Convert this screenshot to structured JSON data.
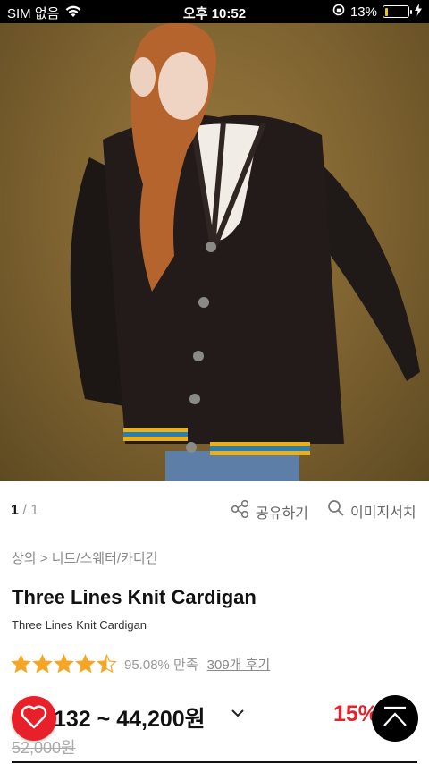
{
  "status_bar": {
    "carrier": "SIM 없음",
    "time": "오후 10:52",
    "battery_percent": "13%",
    "battery_level": 0.13,
    "battery_color": "#f5c400"
  },
  "gallery": {
    "current": "1",
    "separator": " / ",
    "total": "1",
    "share_label": "공유하기",
    "share_icon": "share-icon",
    "image_search_label": "이미지서치",
    "image_search_icon": "search-icon"
  },
  "product": {
    "breadcrumb": "상의 > 니트/스웨터/카디건",
    "title": "Three Lines Knit Cardigan",
    "subtitle": "Three Lines Knit Cardigan",
    "rating_stars": 4.5,
    "star_color": "#f5a623",
    "satisfaction": "95.08% 만족",
    "reviews": "309개 후기",
    "price_range": "132 ~ 44,200원",
    "discount": "15%",
    "original_price": "52,000원",
    "accent_color": "#e8202a"
  },
  "floating": {
    "wish_icon": "heart-icon",
    "top_icon": "scroll-top-icon"
  }
}
